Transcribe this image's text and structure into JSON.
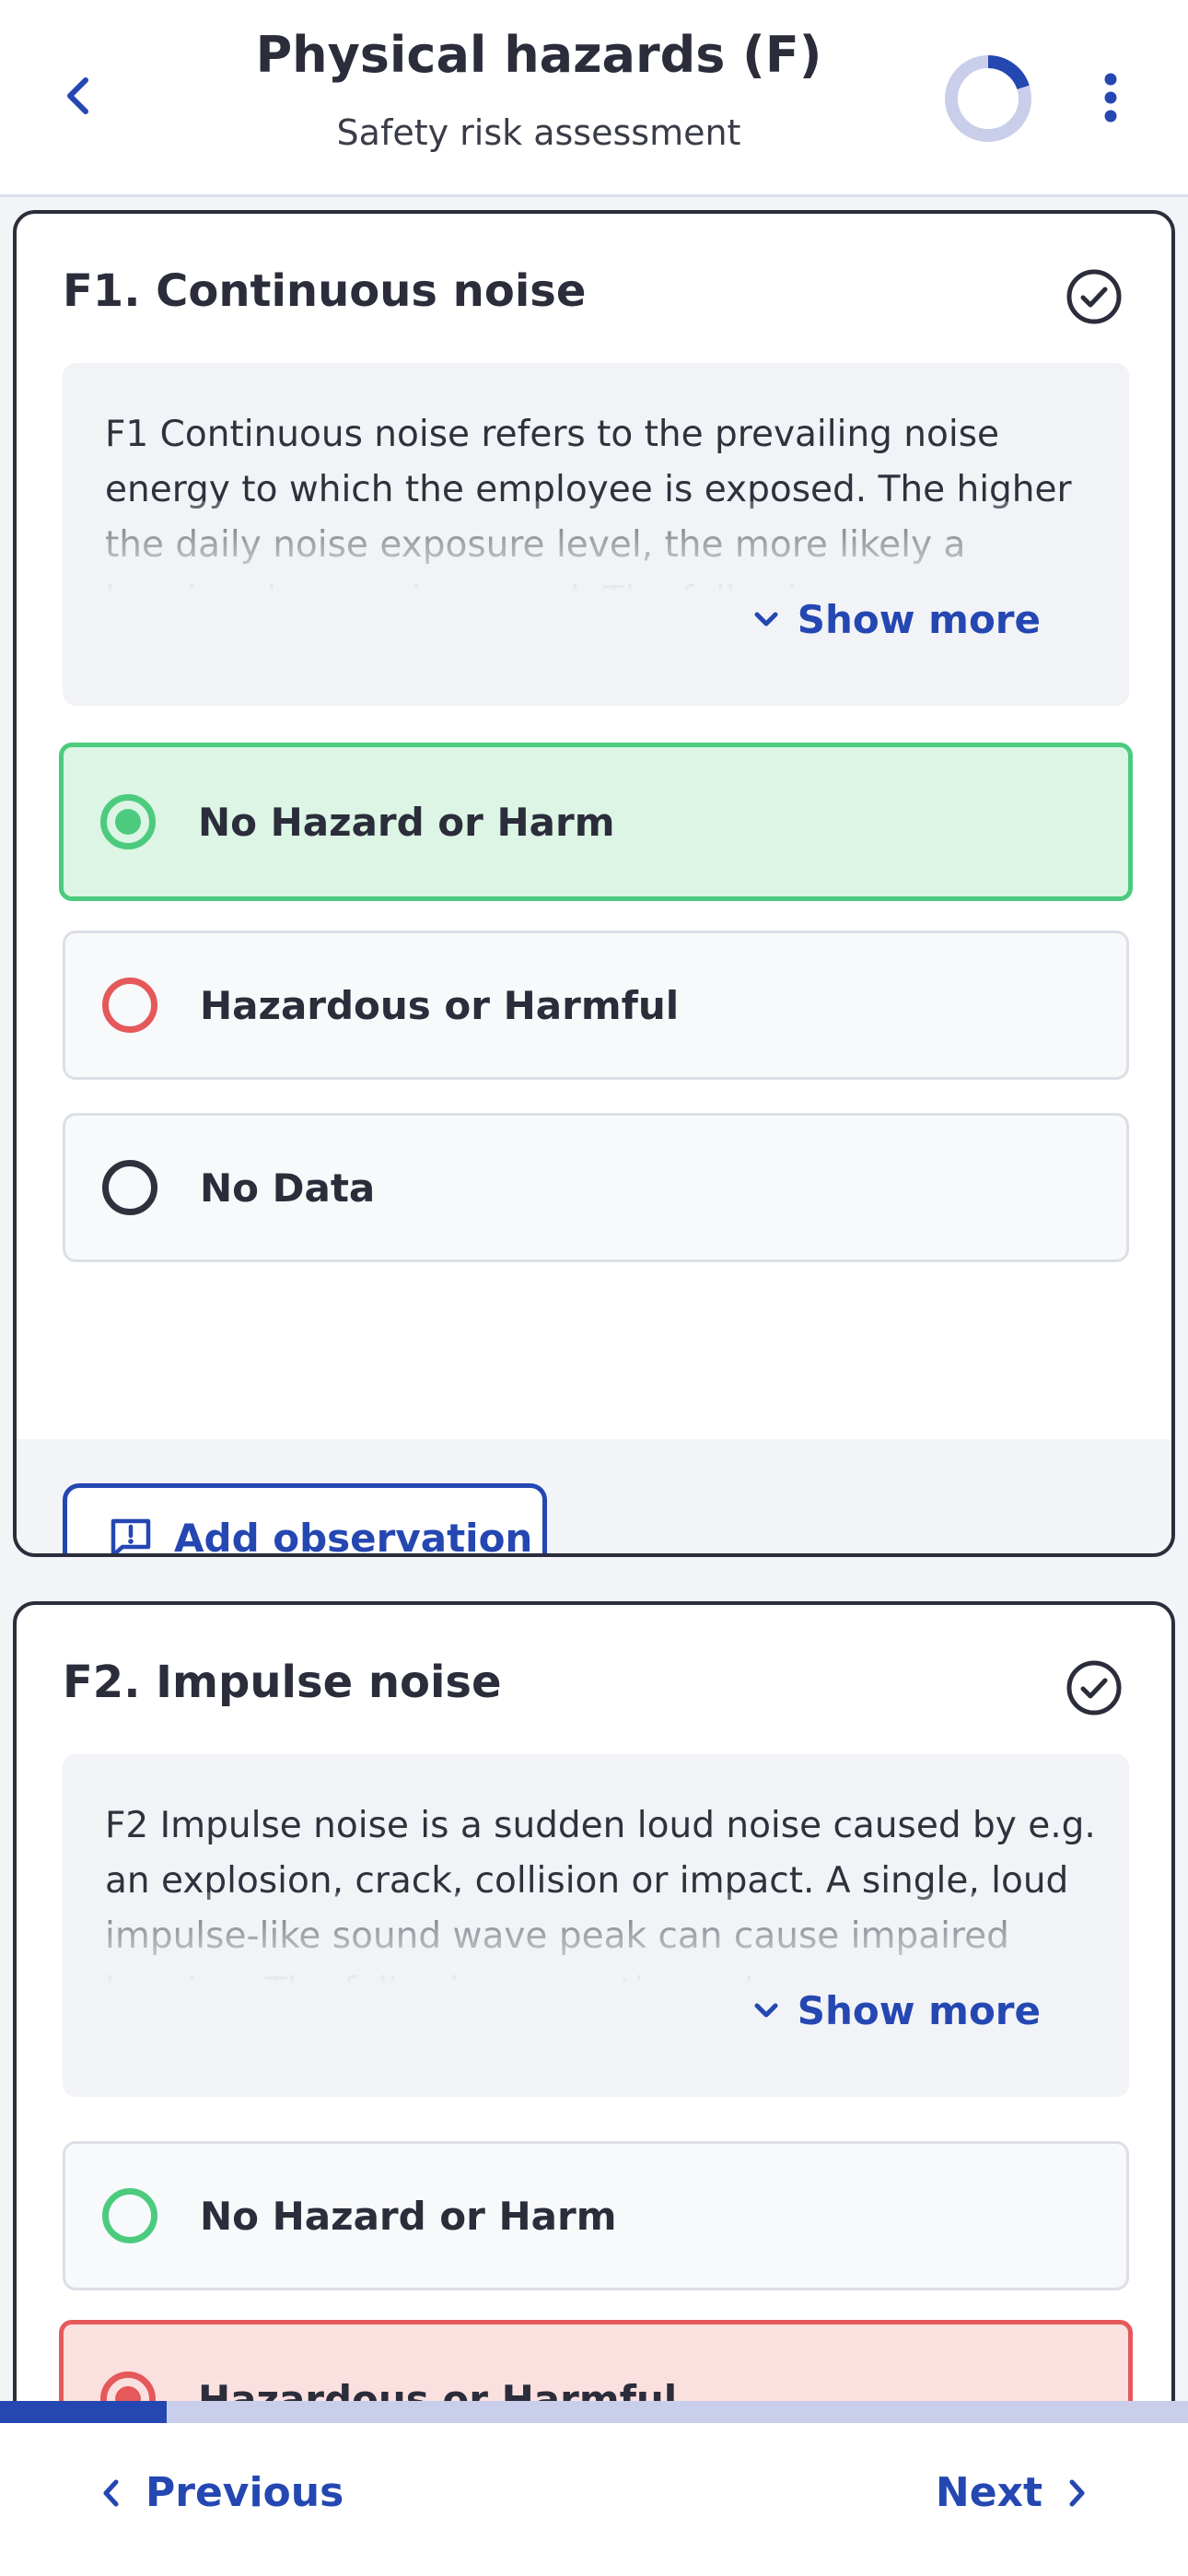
{
  "header": {
    "title": "Physical hazards (F)",
    "subtitle": "Safety risk assessment",
    "back_icon": "chevron-left-icon",
    "more_icon": "more-vertical-icon",
    "progress_fraction": 0.2
  },
  "questions": [
    {
      "title": "F1. Continuous noise",
      "description": "F1 Continuous noise refers to the prevailing noise energy to which the employee is exposed. The higher the daily noise exposure level, the more likely a hearing damage is caused. The following",
      "show_more_label": "Show more",
      "options": [
        {
          "label": "No Hazard or Harm",
          "selected": true
        },
        {
          "label": "Hazardous or Harmful",
          "selected": false
        },
        {
          "label": "No Data",
          "selected": false
        }
      ],
      "add_observation_label": "Add observation"
    },
    {
      "title": "F2. Impulse noise",
      "description": "F2 Impulse noise is a sudden loud noise caused by e.g. an explosion, crack, collision or impact. A single, loud impulse-like sound wave peak can cause impaired hearing. The following operating values",
      "show_more_label": "Show more",
      "options": [
        {
          "label": "No Hazard or Harm",
          "selected": false
        },
        {
          "label": "Hazardous or Harmful",
          "selected": true
        }
      ]
    }
  ],
  "footer": {
    "previous_label": "Previous",
    "next_label": "Next",
    "progress_fraction": 0.14
  },
  "colors": {
    "accent": "#2447b2",
    "safe_green": "#4ccb7e",
    "danger_red": "#e5595a",
    "dark": "#2b2d3b"
  }
}
